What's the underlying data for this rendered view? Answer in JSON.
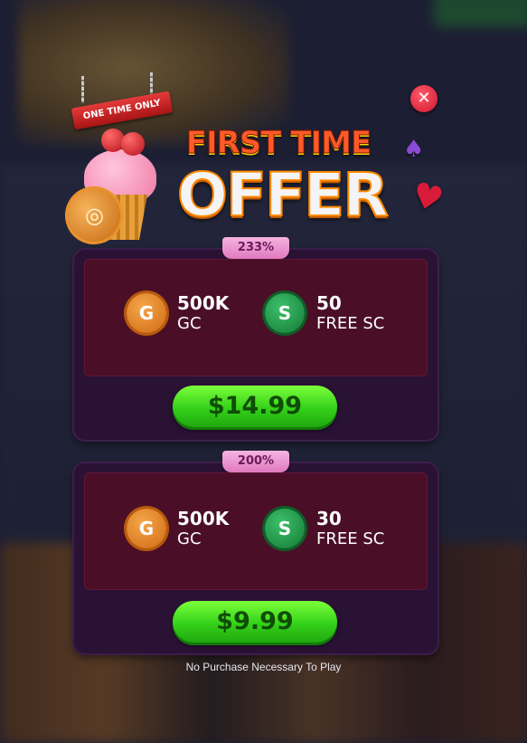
{
  "header": {
    "ribbon": "ONE TIME ONLY",
    "title_line1": "FIRST TIME",
    "title_line2": "OFFER",
    "close_icon": "close-icon"
  },
  "offers": [
    {
      "bonus": "233%",
      "gc_icon": "G",
      "gc_amount": "500K",
      "gc_unit": "GC",
      "sc_icon": "S",
      "sc_amount": "50",
      "sc_unit": "FREE SC",
      "price": "$14.99"
    },
    {
      "bonus": "200%",
      "gc_icon": "G",
      "gc_amount": "500K",
      "gc_unit": "GC",
      "sc_icon": "S",
      "sc_amount": "30",
      "sc_unit": "FREE SC",
      "price": "$9.99"
    }
  ],
  "footer": {
    "disclaimer": "No Purchase Necessary To Play"
  },
  "colors": {
    "buy_button": "#34d11a",
    "card_bg": "#2a1235",
    "card_inner": "#4a0f26",
    "badge": "#e07ac0",
    "gold_coin": "#cf6a12",
    "sweeps_coin": "#137a35"
  }
}
